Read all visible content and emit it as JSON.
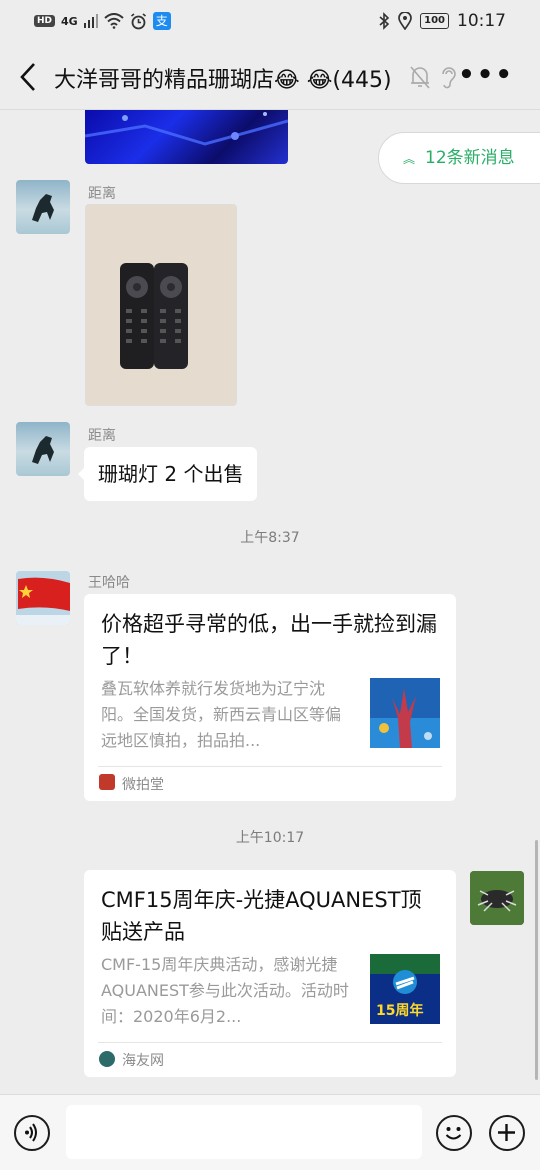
{
  "status_bar": {
    "hd": "HD",
    "signal": "4G",
    "app_badge": "支",
    "battery": "100",
    "time": "10:17"
  },
  "header": {
    "title": "大洋哥哥的精品珊瑚店😂 😂(445)",
    "more": "•••"
  },
  "new_messages_label": "12条新消息",
  "messages": [
    {
      "sender": "距离",
      "type": "image"
    },
    {
      "sender": "距离",
      "text": "珊瑚灯 2 个出售"
    },
    {
      "timestamp": "上午8:37"
    },
    {
      "sender": "王哈哈",
      "card_title": "价格超乎寻常的低，出一手就捡到漏了！",
      "card_desc": "叠瓦软体养就行发货地为辽宁沈阳。全国发货，新西云青山区等偏远地区慎拍，拍品拍...",
      "card_source": "微拍堂"
    },
    {
      "timestamp": "上午10:17"
    },
    {
      "sender": "",
      "card_title": "CMF15周年庆-光捷AQUANEST顶贴送产品",
      "card_desc": "CMF-15周年庆典活动，感谢光捷AQUANEST参与此次活动。活动时间：2020年6月2...",
      "card_thumb_text": "15周年",
      "card_source": "海友网"
    }
  ],
  "colors": {
    "accent_green": "#2aae67",
    "background": "#ededed",
    "bubble": "#ffffff"
  }
}
